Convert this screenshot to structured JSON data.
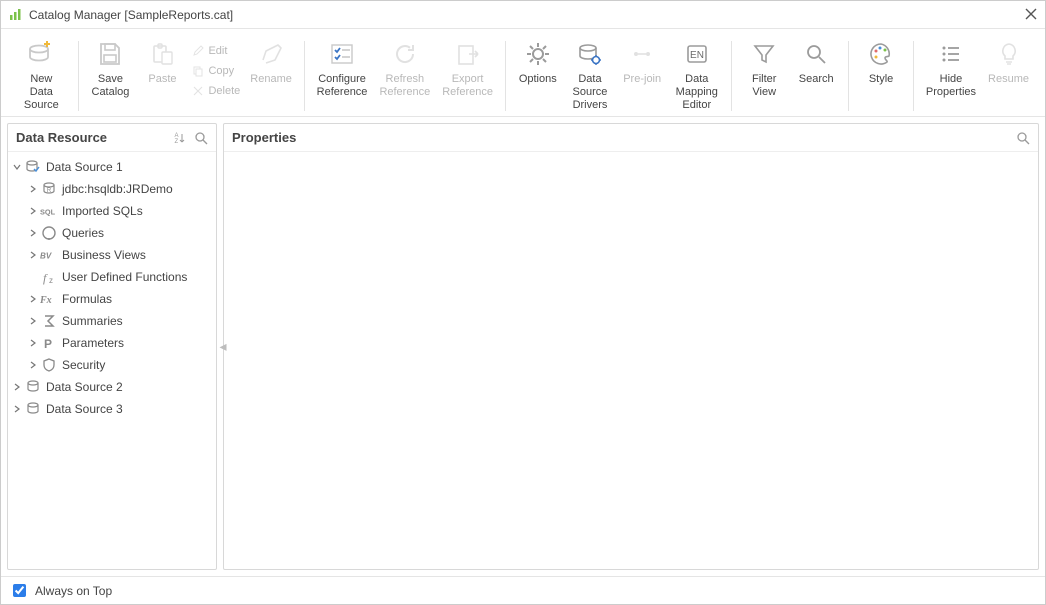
{
  "window": {
    "title": "Catalog Manager [SampleReports.cat]"
  },
  "toolbar": {
    "new_ds": "New\nData Source",
    "save_catalog": "Save\nCatalog",
    "paste": "Paste",
    "edit": "Edit",
    "copy": "Copy",
    "delete": "Delete",
    "rename": "Rename",
    "configure_ref": "Configure\nReference",
    "refresh_ref": "Refresh\nReference",
    "export_ref": "Export\nReference",
    "options": "Options",
    "ds_drivers": "Data Source\nDrivers",
    "pre_join": "Pre-join",
    "data_mapping": "Data Mapping\nEditor",
    "filter_view": "Filter\nView",
    "search": "Search",
    "style": "Style",
    "hide_props": "Hide\nProperties",
    "resume": "Resume"
  },
  "left_panel": {
    "title": "Data Resource",
    "tree": {
      "ds1": {
        "label": "Data Source 1"
      },
      "jdbc": {
        "label": "jdbc:hsqldb:JRDemo"
      },
      "imported_sqls": {
        "label": "Imported SQLs"
      },
      "queries": {
        "label": "Queries"
      },
      "business_views": {
        "label": "Business Views"
      },
      "udf": {
        "label": "User Defined Functions"
      },
      "formulas": {
        "label": "Formulas"
      },
      "summaries": {
        "label": "Summaries"
      },
      "parameters": {
        "label": "Parameters"
      },
      "security": {
        "label": "Security"
      },
      "ds2": {
        "label": "Data Source 2"
      },
      "ds3": {
        "label": "Data Source 3"
      }
    }
  },
  "right_panel": {
    "title": "Properties"
  },
  "statusbar": {
    "always_on_top": "Always on Top",
    "always_on_top_checked": true
  }
}
